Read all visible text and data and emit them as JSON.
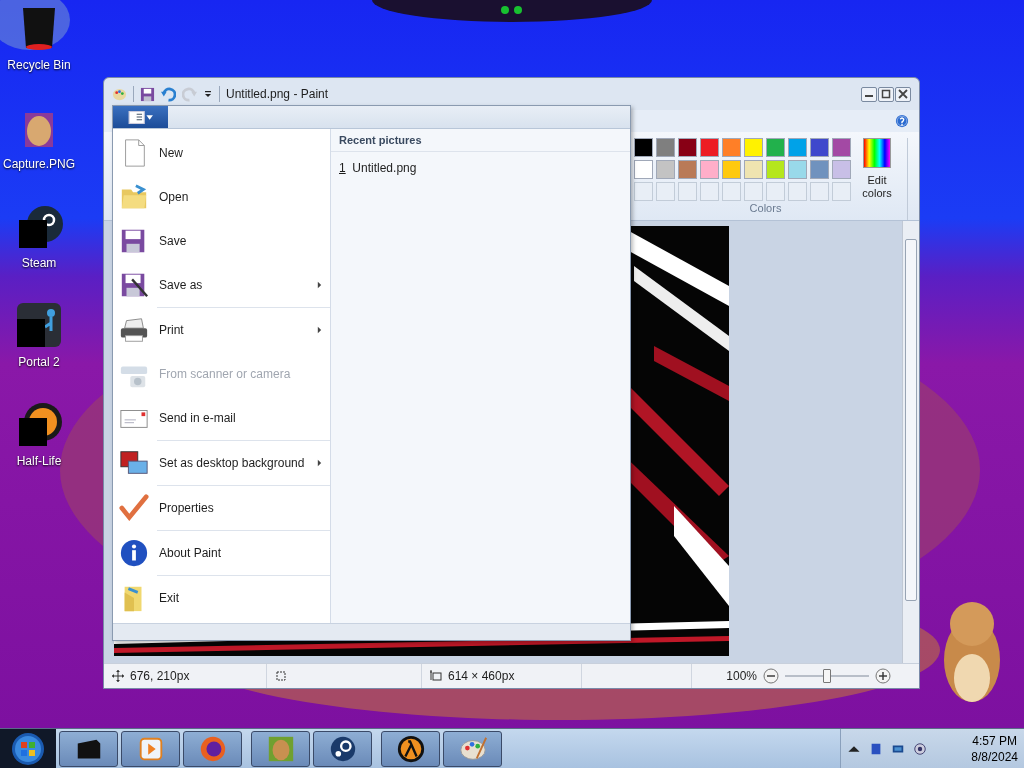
{
  "desktop_icons": [
    {
      "label": "Recycle Bin"
    },
    {
      "label": "Capture.PNG"
    },
    {
      "label": "Steam"
    },
    {
      "label": "Portal 2"
    },
    {
      "label": "Half-Life"
    }
  ],
  "window": {
    "title": "Untitled.png - Paint"
  },
  "file_menu": {
    "groups": [
      [
        {
          "label": "New",
          "kind": "command",
          "disabled": false
        },
        {
          "label": "Open",
          "kind": "command",
          "disabled": false
        },
        {
          "label": "Save",
          "kind": "command",
          "disabled": false
        },
        {
          "label": "Save as",
          "kind": "submenu",
          "disabled": false
        }
      ],
      [
        {
          "label": "Print",
          "kind": "submenu",
          "disabled": false
        },
        {
          "label": "From scanner or camera",
          "kind": "command",
          "disabled": true
        },
        {
          "label": "Send in e-mail",
          "kind": "command",
          "disabled": false
        }
      ],
      [
        {
          "label": "Set as desktop background",
          "kind": "submenu",
          "disabled": false
        }
      ],
      [
        {
          "label": "Properties",
          "kind": "command",
          "disabled": false
        }
      ],
      [
        {
          "label": "About Paint",
          "kind": "command",
          "disabled": false
        }
      ],
      [
        {
          "label": "Exit",
          "kind": "command",
          "disabled": false
        }
      ]
    ],
    "recent_header": "Recent pictures",
    "recent": [
      {
        "number": "1",
        "name": "Untitled.png"
      }
    ]
  },
  "colors": {
    "rows": [
      [
        {
          "color": "#000000"
        },
        {
          "color": "#7f7f7f"
        },
        {
          "color": "#880015"
        },
        {
          "color": "#ed1c24"
        },
        {
          "color": "#ff7f27"
        },
        {
          "color": "#fff200"
        },
        {
          "color": "#22b14c"
        },
        {
          "color": "#00a2e8"
        },
        {
          "color": "#3f48cc"
        },
        {
          "color": "#a349a4"
        }
      ],
      [
        {
          "color": "#ffffff"
        },
        {
          "color": "#c3c3c3"
        },
        {
          "color": "#b97a57"
        },
        {
          "color": "#ffaec9"
        },
        {
          "color": "#ffc90e"
        },
        {
          "color": "#efe4b0"
        },
        {
          "color": "#b5e61d"
        },
        {
          "color": "#99d9ea"
        },
        {
          "color": "#7092be"
        },
        {
          "color": "#c8bfe7"
        }
      ]
    ],
    "edit_label": "Edit colors",
    "group_label": "Colors"
  },
  "status_bar": {
    "cursor": "676, 210px",
    "size": "614 × 460px",
    "zoom": "100%",
    "zoom_slider": {
      "level": 0.5
    }
  },
  "taskbar": {
    "time": "4:57 PM",
    "date": "8/8/2024"
  }
}
